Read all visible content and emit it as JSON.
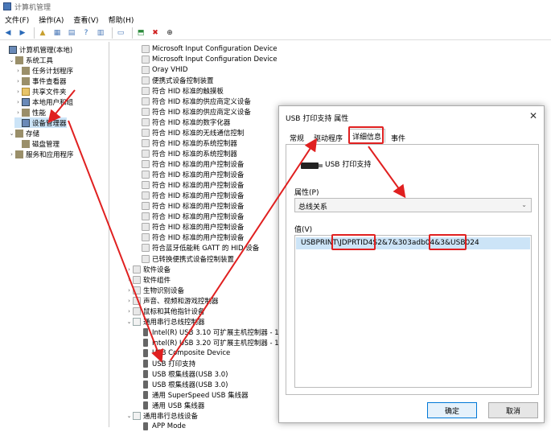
{
  "window": {
    "title": "计算机管理"
  },
  "menu": [
    "文件(F)",
    "操作(A)",
    "查看(V)",
    "帮助(H)"
  ],
  "left_tree": [
    {
      "label": "计算机管理(本地)",
      "indent": 0,
      "arrow": "",
      "icon": "comp"
    },
    {
      "label": "系统工具",
      "indent": 1,
      "arrow": "⌄",
      "icon": "tool"
    },
    {
      "label": "任务计划程序",
      "indent": 2,
      "arrow": "›",
      "icon": "tool"
    },
    {
      "label": "事件查看器",
      "indent": 2,
      "arrow": "›",
      "icon": "tool"
    },
    {
      "label": "共享文件夹",
      "indent": 2,
      "arrow": "›",
      "icon": "fold"
    },
    {
      "label": "本地用户和组",
      "indent": 2,
      "arrow": "›",
      "icon": "comp"
    },
    {
      "label": "性能",
      "indent": 2,
      "arrow": "›",
      "icon": "tool"
    },
    {
      "label": "设备管理器",
      "indent": 2,
      "arrow": "",
      "icon": "comp",
      "selected": true
    },
    {
      "label": "存储",
      "indent": 1,
      "arrow": "⌄",
      "icon": "tool"
    },
    {
      "label": "磁盘管理",
      "indent": 2,
      "arrow": "",
      "icon": "tool"
    },
    {
      "label": "服务和应用程序",
      "indent": 1,
      "arrow": "›",
      "icon": "tool"
    }
  ],
  "device_list": [
    {
      "label": "Microsoft Input Configuration Device",
      "indent": 3,
      "icon": "hid"
    },
    {
      "label": "Microsoft Input Configuration Device",
      "indent": 3,
      "icon": "hid"
    },
    {
      "label": "Oray VHID",
      "indent": 3,
      "icon": "hid"
    },
    {
      "label": "便携式设备控制装置",
      "indent": 3,
      "icon": "hid"
    },
    {
      "label": "符合 HID 标准的触摸板",
      "indent": 3,
      "icon": "hid"
    },
    {
      "label": "符合 HID 标准的供应商定义设备",
      "indent": 3,
      "icon": "hid"
    },
    {
      "label": "符合 HID 标准的供应商定义设备",
      "indent": 3,
      "icon": "hid"
    },
    {
      "label": "符合 HID 标准的数字化器",
      "indent": 3,
      "icon": "hid"
    },
    {
      "label": "符合 HID 标准的无线通信控制",
      "indent": 3,
      "icon": "hid"
    },
    {
      "label": "符合 HID 标准的系统控制器",
      "indent": 3,
      "icon": "hid"
    },
    {
      "label": "符合 HID 标准的系统控制器",
      "indent": 3,
      "icon": "hid"
    },
    {
      "label": "符合 HID 标准的用户控制设备",
      "indent": 3,
      "icon": "hid"
    },
    {
      "label": "符合 HID 标准的用户控制设备",
      "indent": 3,
      "icon": "hid"
    },
    {
      "label": "符合 HID 标准的用户控制设备",
      "indent": 3,
      "icon": "hid"
    },
    {
      "label": "符合 HID 标准的用户控制设备",
      "indent": 3,
      "icon": "hid"
    },
    {
      "label": "符合 HID 标准的用户控制设备",
      "indent": 3,
      "icon": "hid"
    },
    {
      "label": "符合 HID 标准的用户控制设备",
      "indent": 3,
      "icon": "hid"
    },
    {
      "label": "符合 HID 标准的用户控制设备",
      "indent": 3,
      "icon": "hid"
    },
    {
      "label": "符合 HID 标准的用户控制设备",
      "indent": 3,
      "icon": "hid"
    },
    {
      "label": "符合蓝牙低能耗 GATT 的 HID 设备",
      "indent": 3,
      "icon": "hid"
    },
    {
      "label": "已转换便携式设备控制装置",
      "indent": 3,
      "icon": "hid"
    },
    {
      "label": "软件设备",
      "indent": 2,
      "arrow": "›",
      "icon": "hid"
    },
    {
      "label": "软件组件",
      "indent": 2,
      "arrow": "›",
      "icon": "hid"
    },
    {
      "label": "生物识别设备",
      "indent": 2,
      "arrow": "›",
      "icon": "hid"
    },
    {
      "label": "声音、视频和游戏控制器",
      "indent": 2,
      "arrow": "›",
      "icon": "hid"
    },
    {
      "label": "鼠标和其他指针设备",
      "indent": 2,
      "arrow": "›",
      "icon": "hid"
    },
    {
      "label": "通用串行总线控制器",
      "indent": 2,
      "arrow": "⌄",
      "icon": "usb"
    },
    {
      "label": "Intel(R) USB 3.10 可扩展主机控制器 - 1",
      "indent": 3,
      "icon": "plug"
    },
    {
      "label": "Intel(R) USB 3.20 可扩展主机控制器 - 1",
      "indent": 3,
      "icon": "plug"
    },
    {
      "label": "USB Composite Device",
      "indent": 3,
      "icon": "plug"
    },
    {
      "label": "USB 打印支持",
      "indent": 3,
      "icon": "plug"
    },
    {
      "label": "USB 根集线器(USB 3.0)",
      "indent": 3,
      "icon": "plug"
    },
    {
      "label": "USB 根集线器(USB 3.0)",
      "indent": 3,
      "icon": "plug"
    },
    {
      "label": "通用 SuperSpeed USB 集线器",
      "indent": 3,
      "icon": "plug"
    },
    {
      "label": "通用 USB 集线器",
      "indent": 3,
      "icon": "plug"
    },
    {
      "label": "通用串行总线设备",
      "indent": 2,
      "arrow": "⌄",
      "icon": "usb"
    },
    {
      "label": "APP Mode",
      "indent": 3,
      "icon": "plug"
    }
  ],
  "dialog": {
    "title": "USB 打印支持 属性",
    "close": "✕",
    "tabs": [
      "常规",
      "驱动程序",
      "详细信息",
      "事件"
    ],
    "active_tab": 2,
    "device_name": "USB 打印支持",
    "property_label": "属性(P)",
    "property_value": "总线关系",
    "value_label": "值(V)",
    "value_text": "USBPRINT\\JDPRTID4S2&7&303adb04&3&USB024",
    "ok": "确定",
    "cancel": "取消"
  },
  "annotation_color": "#e02020"
}
